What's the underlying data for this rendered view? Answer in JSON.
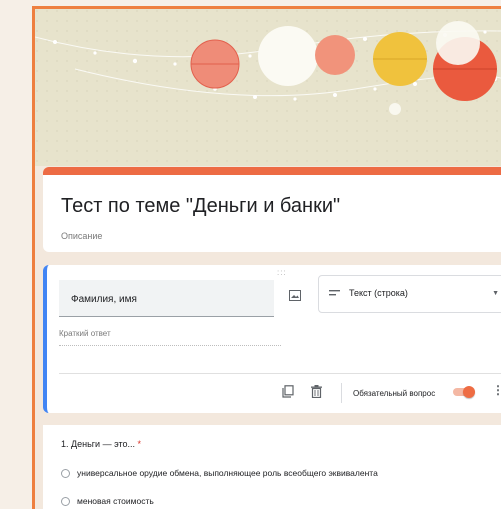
{
  "colors": {
    "accent": "#ed6b44",
    "frame": "#ee7f3f",
    "active_border": "#4285f4",
    "toggle_on": "#ee6c43",
    "required_star": "#d93025"
  },
  "header": {
    "title": "Тест по теме \"Деньги и банки\"",
    "description_placeholder": "Описание"
  },
  "question_editor": {
    "drag_handle": ":::",
    "title_value": "Фамилия, имя",
    "image_icon": "image-icon",
    "type_select": {
      "icon": "short-text-icon",
      "label": "Текст (строка)",
      "caret": "▼"
    },
    "answer_placeholder": "Краткий ответ",
    "footer": {
      "copy_icon": "copy-icon",
      "delete_icon": "trash-icon",
      "required_label": "Обязательный вопрос",
      "required_on": true,
      "more_icon": "⋮"
    }
  },
  "question_1": {
    "title": "1. Деньги — это...",
    "required_marker": "*",
    "options": [
      "универсальное орудие обмена, выполняющее роль всеобщего эквивалента",
      "меновая стоимость"
    ]
  }
}
